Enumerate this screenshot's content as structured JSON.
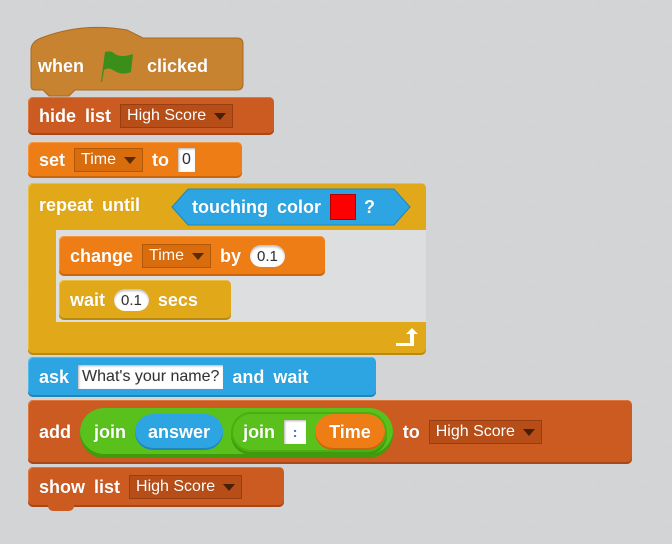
{
  "colors": {
    "events": "#c88330",
    "lists": "#cc5b22",
    "data": "#ee7d16",
    "control": "#e1a91a",
    "sensing": "#2ca5e2",
    "operators": "#59c01c",
    "flag": "#3b8e1a",
    "touch_color": "#ff0000",
    "background": "#dcdedf"
  },
  "script": {
    "hat": {
      "when": "when",
      "flag_icon": "green-flag-icon",
      "clicked": "clicked"
    },
    "hide_list": {
      "w1": "hide",
      "w2": "list",
      "list": "High Score"
    },
    "set_var": {
      "w1": "set",
      "var": "Time",
      "w2": "to",
      "value": "0"
    },
    "repeat_until": {
      "w1": "repeat",
      "w2": "until",
      "condition": {
        "w1": "touching",
        "w2": "color",
        "q": "?"
      }
    },
    "change_var": {
      "w1": "change",
      "var": "Time",
      "w2": "by",
      "value": "0.1"
    },
    "wait": {
      "w1": "wait",
      "value": "0.1",
      "w2": "secs"
    },
    "ask": {
      "w1": "ask",
      "question": "What's your name?",
      "w2": "and",
      "w3": "wait"
    },
    "add_to_list": {
      "w1": "add",
      "join1": "join",
      "answer": "answer",
      "join2": "join",
      "separator": ":",
      "time": "Time",
      "w2": "to",
      "list": "High Score"
    },
    "show_list": {
      "w1": "show",
      "w2": "list",
      "list": "High Score"
    }
  }
}
